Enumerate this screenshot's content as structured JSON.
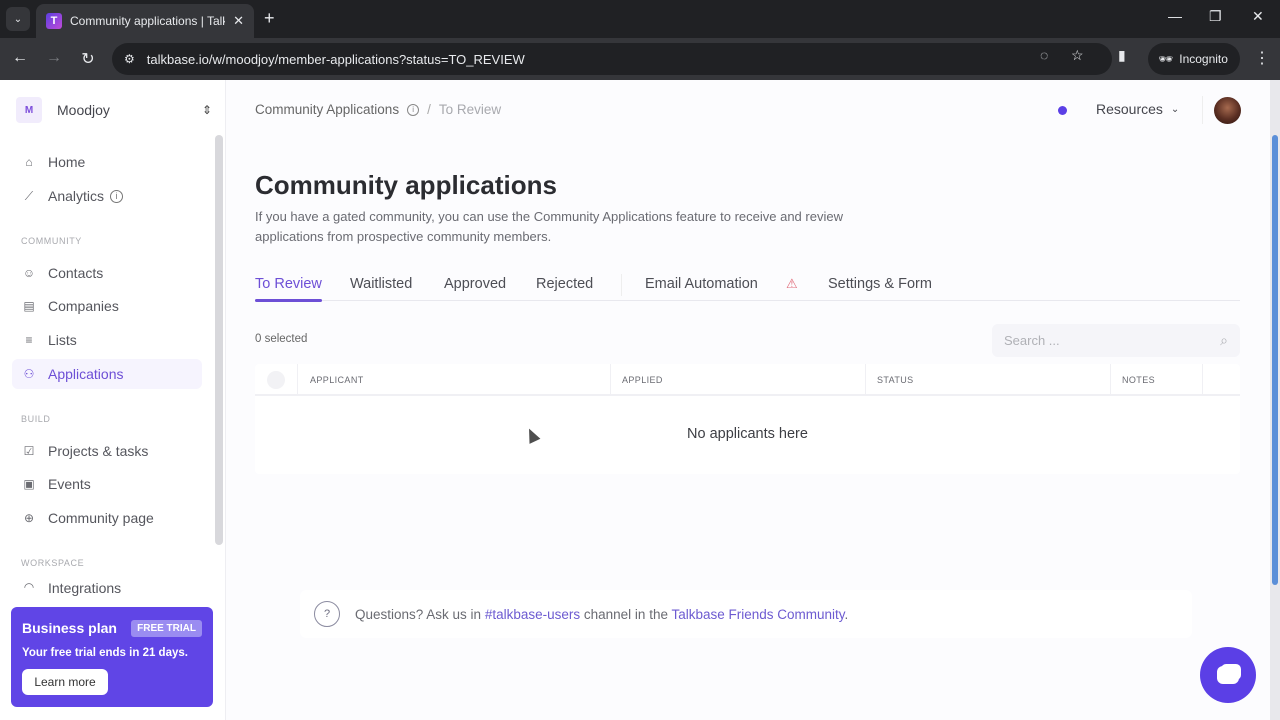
{
  "browser": {
    "tab_title": "Community applications | Talkbase",
    "tab_favicon": "T",
    "url": "talkbase.io/w/moodjoy/member-applications?status=TO_REVIEW",
    "incognito_label": "Incognito",
    "icons": {
      "tab_list": "⌄",
      "close_tab": "✕",
      "new_tab": "+",
      "minimize": "—",
      "restore": "❐",
      "close_window": "✕",
      "back": "←",
      "forward": "→",
      "reload": "↻",
      "site_info": "⚙",
      "eye_off": "◌",
      "star": "☆",
      "side_panel": "▮",
      "incognito": "🕶",
      "menu": "⋮"
    }
  },
  "sidebar": {
    "workspace": {
      "initial": "M",
      "name": "Moodjoy",
      "switch_icon": "⇕"
    },
    "items_top": [
      {
        "label": "Home",
        "icon": "⌂"
      },
      {
        "label": "Analytics",
        "icon": "⟋",
        "info": "i"
      }
    ],
    "section_community": "COMMUNITY",
    "items_community": [
      {
        "label": "Contacts",
        "icon": "☺"
      },
      {
        "label": "Companies",
        "icon": "▤"
      },
      {
        "label": "Lists",
        "icon": "≡"
      },
      {
        "label": "Applications",
        "icon": "⚇",
        "active": true
      }
    ],
    "section_build": "BUILD",
    "items_build": [
      {
        "label": "Projects & tasks",
        "icon": "☑"
      },
      {
        "label": "Events",
        "icon": "▣"
      },
      {
        "label": "Community page",
        "icon": "⊕"
      }
    ],
    "section_workspace": "WORKSPACE",
    "items_workspace": [
      {
        "label": "Integrations",
        "icon": "◠"
      }
    ],
    "promo": {
      "title": "Business plan",
      "badge": "FREE TRIAL",
      "text": "Your free trial ends in 21 days.",
      "button": "Learn more"
    }
  },
  "header": {
    "breadcrumb": {
      "parent": "Community Applications",
      "info": "i",
      "separator": "/",
      "current": "To Review"
    },
    "resources_label": "Resources",
    "chevron": "⌄"
  },
  "main": {
    "title": "Community applications",
    "description": "If you have a gated community, you can use the Community Applications feature to receive and review applications from prospective community members.",
    "tabs": [
      {
        "label": "To Review",
        "active": true
      },
      {
        "label": "Waitlisted"
      },
      {
        "label": "Approved"
      },
      {
        "label": "Rejected"
      },
      {
        "label": "Email Automation",
        "warning_icon": "⚠"
      },
      {
        "label": "Settings & Form"
      }
    ],
    "selected_count": "0 selected",
    "search": {
      "placeholder": "Search ...",
      "value": "",
      "icon": "⌕"
    },
    "table": {
      "columns": [
        "APPLICANT",
        "APPLIED",
        "STATUS",
        "NOTES"
      ],
      "rows": [],
      "empty_message": "No applicants here"
    },
    "help": {
      "icon": "?",
      "prefix": "Questions? Ask us in ",
      "channel_link": "#talkbase-users",
      "middle": " channel in the ",
      "community_link": "Talkbase Friends Community",
      "suffix": "."
    }
  },
  "colors": {
    "accent": "#6d4fd6",
    "brand": "#5b3fe6",
    "promo_bg": "#6045e6",
    "warning": "#e06a78"
  }
}
